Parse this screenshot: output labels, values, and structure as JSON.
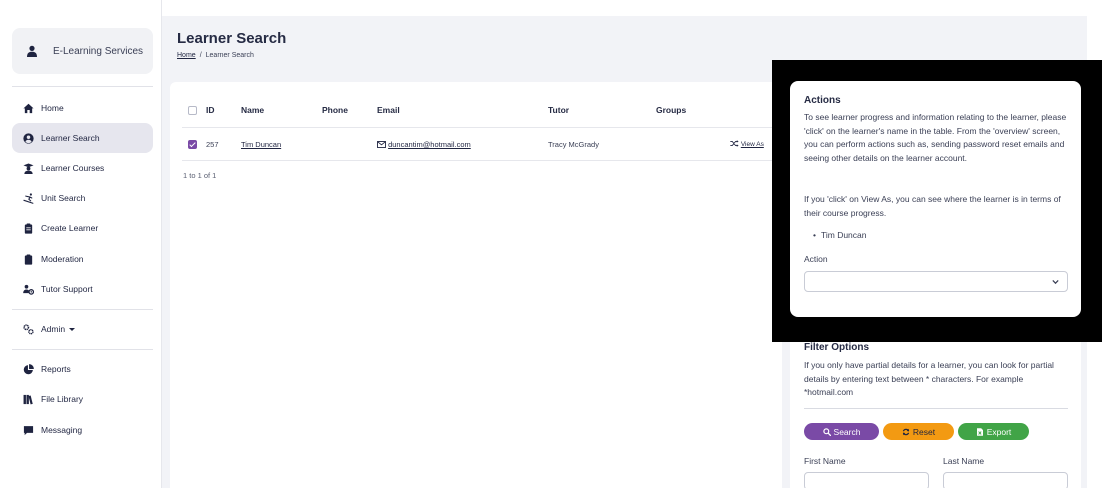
{
  "user": {
    "name": "E-Learning Services"
  },
  "nav": {
    "home": "Home",
    "learner_search": "Learner Search",
    "learner_courses": "Learner Courses",
    "unit_search": "Unit Search",
    "create_learner": "Create Learner",
    "moderation": "Moderation",
    "tutor_support": "Tutor Support",
    "admin": "Admin",
    "reports": "Reports",
    "file_library": "File Library",
    "messaging": "Messaging"
  },
  "page": {
    "title": "Learner Search",
    "breadcrumb_home": "Home",
    "breadcrumb_separator": "/",
    "breadcrumb_current": "Learner Search"
  },
  "table": {
    "headers": {
      "id": "ID",
      "name": "Name",
      "phone": "Phone",
      "email": "Email",
      "tutor": "Tutor",
      "groups": "Groups"
    },
    "rows": [
      {
        "id": "257",
        "name": "Tim Duncan",
        "phone": "",
        "email": "duncantim@hotmail.com",
        "tutor": "Tracy McGrady",
        "groups": "",
        "action": "View As",
        "selected": true
      }
    ],
    "count_text": "1 to 1 of 1"
  },
  "actions_panel": {
    "title": "Actions",
    "para1": "To see learner progress and information relating to the learner, please 'click' on the learner's name in the table. From the 'overview' screen, you can perform actions such as, sending password reset emails and seeing other details on the learner account.",
    "para2": "If you 'click' on View As, you can see where the learner is in terms of their course progress.",
    "selected_learner": "Tim Duncan",
    "action_label": "Action",
    "action_value": ""
  },
  "filter_panel": {
    "title": "Filter Options",
    "description": "If you only have partial details for a learner, you can look for partial details by entering text between * characters. For example *hotmail.com",
    "search_label": "Search",
    "reset_label": "Reset",
    "export_label": "Export",
    "first_name_label": "First Name",
    "last_name_label": "Last Name"
  },
  "colors": {
    "accent_purple": "#7a4aa6",
    "reset_orange": "#f39a12",
    "export_green": "#41a447",
    "page_background": "#f2f3f7"
  }
}
